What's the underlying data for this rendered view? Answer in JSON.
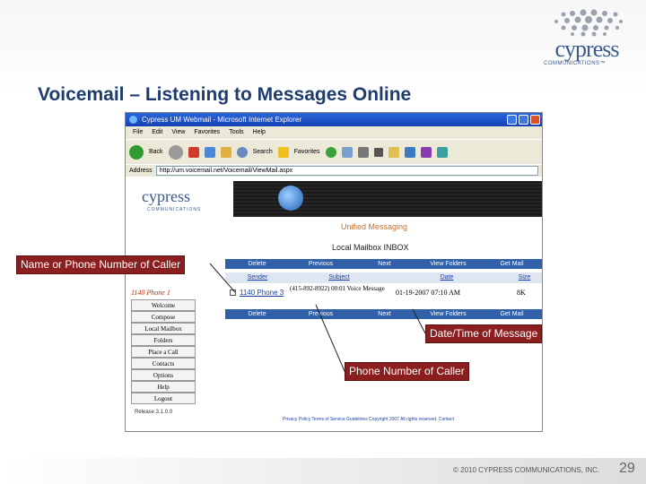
{
  "slide": {
    "title": "Voicemail – Listening to Messages Online",
    "logo_word": "cypress",
    "logo_sub": "COMMUNICATIONS™",
    "copyright": "© 2010 CYPRESS COMMUNICATIONS, INC.",
    "page_number": "29"
  },
  "browser": {
    "title": "Cypress UM Webmail - Microsoft Internet Explorer",
    "menu": [
      "File",
      "Edit",
      "View",
      "Favorites",
      "Tools",
      "Help"
    ],
    "toolbar": {
      "back": "Back",
      "search": "Search",
      "favorites": "Favorites"
    },
    "address_label": "Address",
    "address": "http://um.voicemail.net/Voicemail/ViewMail.aspx"
  },
  "page": {
    "logo": "cypress",
    "logo_sub": "COMMUNICATIONS",
    "app_title": "Unified Messaging",
    "mailbox_title": "Local Mailbox   INBOX",
    "buttons": [
      "Delete",
      "Previous",
      "Next",
      "View Folders",
      "Get Mail"
    ],
    "columns": [
      "Sender",
      "Subject",
      "Date",
      "Size"
    ],
    "message": {
      "sender": "1140 Phone 3",
      "subject": "(415-892-8922) 00:01 Voice Message",
      "date": "01-19-2007 07:10 AM",
      "size": "8K"
    },
    "sidebar": {
      "heading": "1140 Phone 1",
      "items": [
        "Welcome",
        "Compose",
        "Local Mailbox",
        "Folders",
        "Place a Call",
        "Contacts",
        "Options",
        "Help",
        "Logout"
      ],
      "version": "Release 3.1.0.0"
    },
    "footer_links": "Privacy Policy    Terms of Service    Guidelines    Copyright 2007 All rights reserved. Contact"
  },
  "callouts": {
    "name_caller": "Name or Phone Number of Caller",
    "date_time": "Date/Time of Message",
    "phone_caller": "Phone Number of Caller"
  },
  "colors": {
    "title": "#1f3c6e",
    "callout_bg": "#8b1e1e",
    "button_bar": "#3060a8"
  }
}
